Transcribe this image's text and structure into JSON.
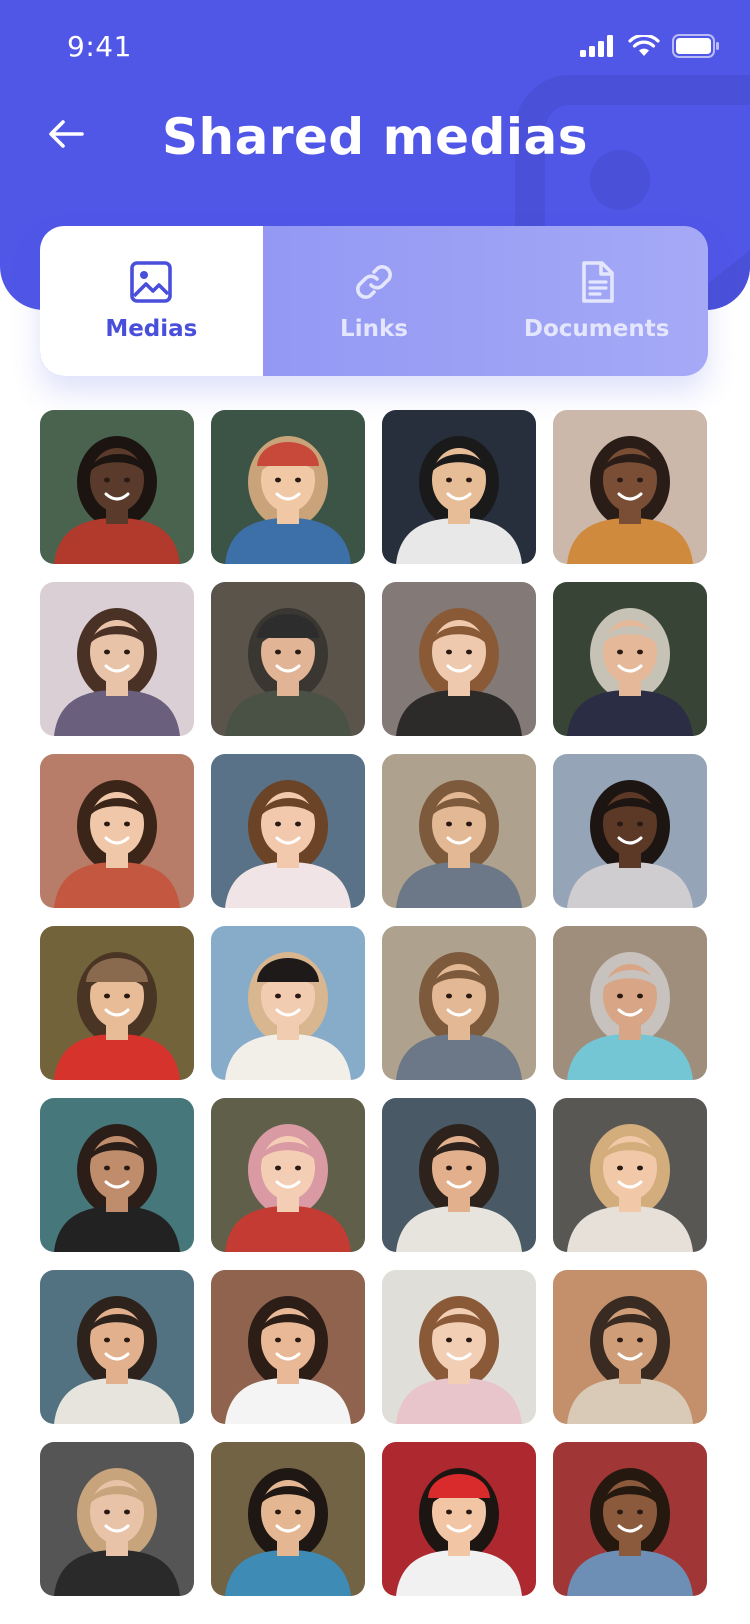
{
  "status_bar": {
    "time": "9:41"
  },
  "header": {
    "title": "Shared medias",
    "back_icon": "arrow-left-icon"
  },
  "tabs": [
    {
      "label": "Medias",
      "icon": "image-icon",
      "active": true
    },
    {
      "label": "Links",
      "icon": "link-icon",
      "active": false
    },
    {
      "label": "Documents",
      "icon": "document-icon",
      "active": false
    }
  ],
  "colors": {
    "accent": "#5056e6",
    "tab_active_text": "#4a4fdb",
    "tab_inactive_text": "#e4e6fd"
  },
  "media": [
    {
      "bg": "#3f5a45",
      "hair": "#1c1411",
      "skin": "#5a3a2a",
      "shirt": "#b23a2c",
      "hat": null
    },
    {
      "bg": "#2f4a3a",
      "hair": "#c9a37a",
      "skin": "#f0c8a6",
      "shirt": "#3d6fa8",
      "hat": "#c8493a"
    },
    {
      "bg": "#1a2230",
      "hair": "#1a1a1a",
      "skin": "#e7bd98",
      "shirt": "#e8e8e8",
      "hat": null
    },
    {
      "bg": "#c9b4a5",
      "hair": "#2a1d17",
      "skin": "#7a4e35",
      "shirt": "#d08a3d",
      "hat": null
    },
    {
      "bg": "#d8cdd2",
      "hair": "#4a3126",
      "skin": "#e9c3a8",
      "shirt": "#6a5f7c",
      "hat": null
    },
    {
      "bg": "#514a40",
      "hair": "#3a3632",
      "skin": "#e0b494",
      "shirt": "#4a5246",
      "hat": "#2d2d2d"
    },
    {
      "bg": "#7c7270",
      "hair": "#8a5a37",
      "skin": "#efc9ae",
      "shirt": "#2d2a2a",
      "hat": null
    },
    {
      "bg": "#2c3a2a",
      "hair": "#c7c2b6",
      "skin": "#e6b89a",
      "shirt": "#2a2d44",
      "hat": null
    },
    {
      "bg": "#b37560",
      "hair": "#3b2518",
      "skin": "#f1c7a9",
      "shirt": "#c3573f",
      "hat": null
    },
    {
      "bg": "#506a80",
      "hair": "#6b4327",
      "skin": "#f2c9ad",
      "shirt": "#f0e4e6",
      "hat": null
    },
    {
      "bg": "#a99c86",
      "hair": "#7d5a3c",
      "skin": "#e3b894",
      "shirt": "#6c7887",
      "hat": null
    },
    {
      "bg": "#8fa0b3",
      "hair": "#1c1512",
      "skin": "#5c3826",
      "shirt": "#d0cdd0",
      "hat": null
    },
    {
      "bg": "#6a5a2f",
      "hair": "#4a3525",
      "skin": "#e9bc98",
      "shirt": "#d6332d",
      "hat": "#8a6a4f"
    },
    {
      "bg": "#7fa7c7",
      "hair": "#d7b690",
      "skin": "#f2ccb1",
      "shirt": "#f2efe9",
      "hat": "#1e1a19"
    },
    {
      "bg": "#a99c86",
      "hair": "#7d5a3c",
      "skin": "#e3b894",
      "shirt": "#6c7887",
      "hat": null
    },
    {
      "bg": "#9b8775",
      "hair": "#c7c2bd",
      "skin": "#d9a587",
      "shirt": "#74c6d4",
      "hat": null
    },
    {
      "bg": "#3b6f73",
      "hair": "#2b1e18",
      "skin": "#c08d6c",
      "shirt": "#222222",
      "hat": null
    },
    {
      "bg": "#56553f",
      "hair": "#d99aa3",
      "skin": "#f4cdb5",
      "shirt": "#c43b33",
      "hat": null
    },
    {
      "bg": "#3e4f5d",
      "hair": "#2d231c",
      "skin": "#e2b08d",
      "shirt": "#e6e4dc",
      "hat": null
    },
    {
      "bg": "#4f4d4a",
      "hair": "#d3ad7c",
      "skin": "#f1c8a8",
      "shirt": "#e6e0d8",
      "hat": null
    },
    {
      "bg": "#496a7a",
      "hair": "#2d231c",
      "skin": "#e2b08d",
      "shirt": "#e6e4dc",
      "hat": null
    },
    {
      "bg": "#8a5a44",
      "hair": "#2c1d16",
      "skin": "#e9b896",
      "shirt": "#f4f4f4",
      "hat": null
    },
    {
      "bg": "#dfdcd6",
      "hair": "#8a5a38",
      "skin": "#f2ceb5",
      "shirt": "#e8c4cb",
      "hat": null
    },
    {
      "bg": "#c08a62",
      "hair": "#3a2b22",
      "skin": "#cf9e79",
      "shirt": "#d9c9b7",
      "hat": null
    },
    {
      "bg": "#4b4b4b",
      "hair": "#c7a47b",
      "skin": "#e9c3a8",
      "shirt": "#2a2a2a",
      "hat": null
    },
    {
      "bg": "#6a5a3a",
      "hair": "#1f1713",
      "skin": "#e4b792",
      "shirt": "#3e8bb6",
      "hat": null
    },
    {
      "bg": "#a81c23",
      "hair": "#1d1512",
      "skin": "#f2c6a5",
      "shirt": "#f1f1f1",
      "hat": "#d92b2b"
    },
    {
      "bg": "#9c2a2a",
      "hair": "#24180f",
      "skin": "#8b5a3c",
      "shirt": "#6d8fb6",
      "hat": null
    }
  ]
}
